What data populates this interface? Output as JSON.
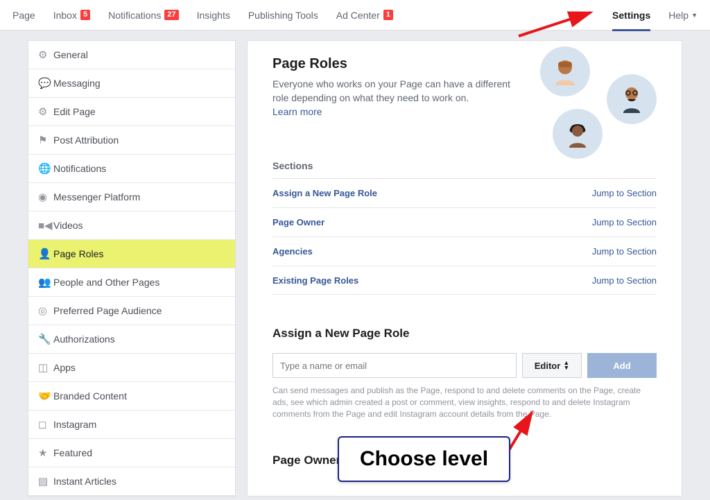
{
  "topnav": {
    "page": "Page",
    "inbox": "Inbox",
    "inbox_badge": "5",
    "notifications": "Notifications",
    "notifications_badge": "27",
    "insights": "Insights",
    "publishing_tools": "Publishing Tools",
    "ad_center": "Ad Center",
    "ad_center_badge": "1",
    "settings": "Settings",
    "help": "Help"
  },
  "sidebar": {
    "items": [
      {
        "label": "General"
      },
      {
        "label": "Messaging"
      },
      {
        "label": "Edit Page"
      },
      {
        "label": "Post Attribution"
      },
      {
        "label": "Notifications"
      },
      {
        "label": "Messenger Platform"
      },
      {
        "label": "Videos"
      },
      {
        "label": "Page Roles"
      },
      {
        "label": "People and Other Pages"
      },
      {
        "label": "Preferred Page Audience"
      },
      {
        "label": "Authorizations"
      },
      {
        "label": "Apps"
      },
      {
        "label": "Branded Content"
      },
      {
        "label": "Instagram"
      },
      {
        "label": "Featured"
      },
      {
        "label": "Instant Articles"
      }
    ]
  },
  "main": {
    "title": "Page Roles",
    "subtitle": "Everyone who works on your Page can have a different role depending on what they need to work on.",
    "learn_more": "Learn more",
    "sections_heading": "Sections",
    "sections": [
      {
        "name": "Assign a New Page Role",
        "jump": "Jump to Section"
      },
      {
        "name": "Page Owner",
        "jump": "Jump to Section"
      },
      {
        "name": "Agencies",
        "jump": "Jump to Section"
      },
      {
        "name": "Existing Page Roles",
        "jump": "Jump to Section"
      }
    ],
    "assign_heading": "Assign a New Page Role",
    "name_placeholder": "Type a name or email",
    "role_selected": "Editor",
    "add_label": "Add",
    "role_desc": "Can send messages and publish as the Page, respond to and delete comments on the Page, create ads, see which admin created a post or comment, view insights, respond to and delete Instagram comments from the Page and edit Instagram account details from the Page.",
    "owner_heading": "Page Owner"
  },
  "annotation": {
    "callout": "Choose level"
  }
}
